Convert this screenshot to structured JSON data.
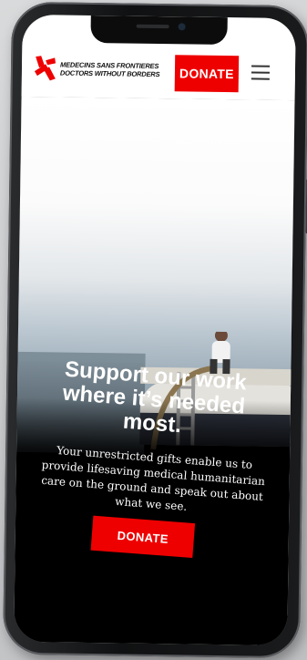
{
  "header": {
    "logo_line1": "MEDECINS SANS FRONTIERES",
    "logo_line2": "DOCTORS WITHOUT BORDERS",
    "donate_label": "DONATE"
  },
  "hero": {
    "headline": "Support our work where it’s needed most.",
    "body": "Your unrestricted gifts enable us to provide lifesaving medical humanitarian care on the ground and speak out about what we see.",
    "donate_label": "DONATE"
  },
  "colors": {
    "brand_red": "#ee0000",
    "background": "#000000"
  },
  "icons": [
    "msf-logo-icon",
    "hamburger-menu-icon"
  ]
}
